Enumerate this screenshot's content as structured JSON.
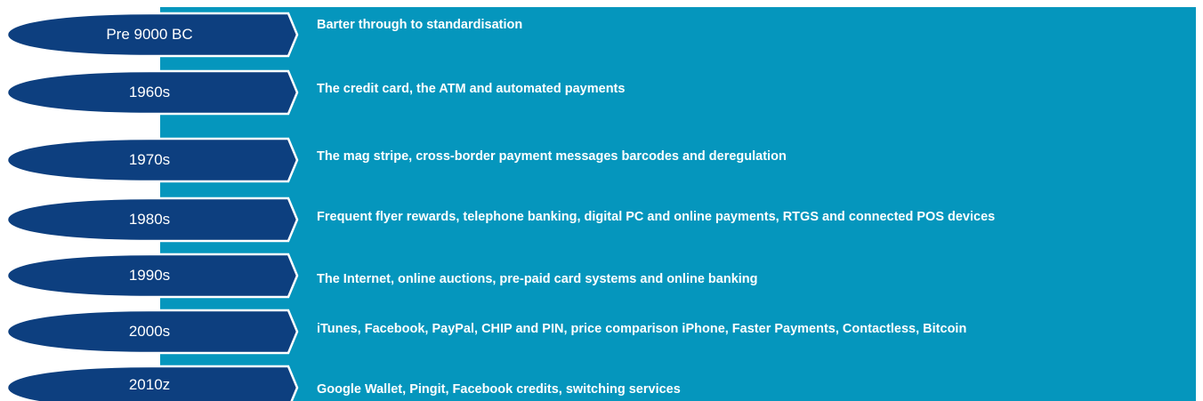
{
  "colors": {
    "panel": "#0596bd",
    "oval_fill": "#0d3f7f",
    "oval_outline": "#ffffff",
    "text": "#ffffff"
  },
  "timeline": [
    {
      "era": "Pre 9000 BC",
      "description": "Barter through to standardisation"
    },
    {
      "era": "1960s",
      "description": "The credit card, the ATM and automated payments"
    },
    {
      "era": "1970s",
      "description": "The mag stripe, cross-border payment messages barcodes and deregulation"
    },
    {
      "era": "1980s",
      "description": "Frequent flyer rewards, telephone banking, digital PC and online payments, RTGS and connected POS devices"
    },
    {
      "era": "1990s",
      "description": "The Internet, online auctions, pre-paid card systems and online banking"
    },
    {
      "era": "2000s",
      "description": "iTunes, Facebook, PayPal, CHIP and PIN, price comparison iPhone, Faster Payments, Contactless, Bitcoin"
    },
    {
      "era": "2010z",
      "description": "Google Wallet, Pingit, Facebook credits, switching services"
    }
  ]
}
